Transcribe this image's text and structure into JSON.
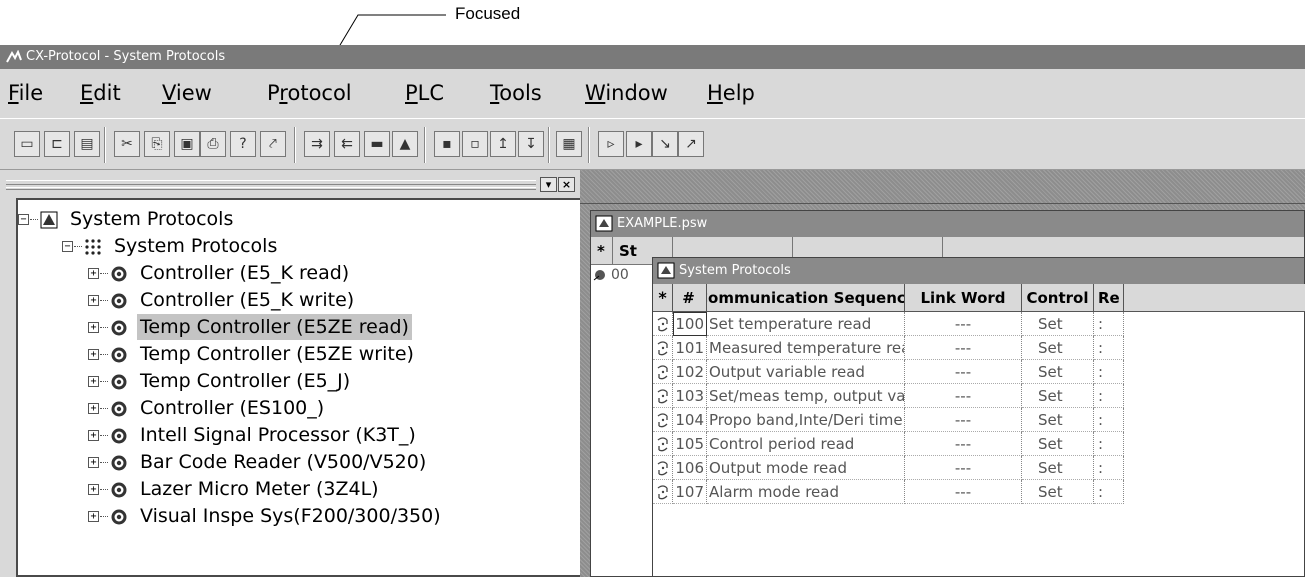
{
  "callout": {
    "label": "Focused"
  },
  "window": {
    "title": "CX-Protocol - System Protocols"
  },
  "menu": [
    {
      "label": "File",
      "underline": "F",
      "rest": "ile"
    },
    {
      "label": "Edit",
      "underline": "E",
      "rest": "dit"
    },
    {
      "label": "View",
      "underline": "V",
      "rest": "iew"
    },
    {
      "label": "Protocol",
      "underline": "r",
      "pre": "P",
      "rest": "otocol"
    },
    {
      "label": "PLC",
      "underline": "P",
      "rest": "LC"
    },
    {
      "label": "Tools",
      "underline": "T",
      "rest": "ools"
    },
    {
      "label": "Window",
      "underline": "W",
      "rest": "indow"
    },
    {
      "label": "Help",
      "underline": "H",
      "rest": "elp"
    }
  ],
  "toolbar": {
    "icons": [
      "new-icon",
      "open-icon",
      "save-icon",
      "cut-icon",
      "copy-icon",
      "paste-icon",
      "print-icon",
      "help-icon",
      "context-help-icon",
      "send-icon",
      "receive-icon",
      "stop-icon",
      "eject-icon",
      "trace-icon",
      "trace-stop-icon",
      "trace-up-icon",
      "trace-down-icon",
      "monitor-icon",
      "step-icon",
      "step-p-icon",
      "step-in-icon",
      "step-out-icon"
    ]
  },
  "tree": {
    "root": "System Protocols",
    "group": "System Protocols",
    "items": [
      "Controller (E5_K read)",
      "Controller (E5_K write)",
      "Temp Controller (E5ZE read)",
      "Temp Controller (E5ZE write)",
      "Temp Controller (E5_J)",
      "Controller (ES100_)",
      "Intell Signal Processor (K3T_)",
      "Bar Code Reader (V500/V520)",
      "Lazer Micro Meter (3Z4L)",
      "Visual Inspe Sys(F200/300/350)"
    ],
    "selected_index": 2
  },
  "example_window": {
    "title": "EXAMPLE.psw",
    "head_star": "*",
    "head_col": "St",
    "row_no": "00"
  },
  "system_window": {
    "title": "System Protocols",
    "headers": {
      "star": "*",
      "no": "#",
      "seq": "Communication Sequence",
      "link": "Link Word",
      "control": "Control",
      "r": "Re"
    },
    "rows": [
      {
        "no": "100",
        "seq": "Set temperature read",
        "link": "---",
        "control": "Set",
        "r": ":"
      },
      {
        "no": "101",
        "seq": "Measured temperature read",
        "link": "---",
        "control": "Set",
        "r": ":"
      },
      {
        "no": "102",
        "seq": "Output variable read",
        "link": "---",
        "control": "Set",
        "r": ":"
      },
      {
        "no": "103",
        "seq": "Set/meas temp, output var read",
        "link": "---",
        "control": "Set",
        "r": ":"
      },
      {
        "no": "104",
        "seq": "Propo band,Inte/Deri time read",
        "link": "---",
        "control": "Set",
        "r": ":"
      },
      {
        "no": "105",
        "seq": "Control period read",
        "link": "---",
        "control": "Set",
        "r": ":"
      },
      {
        "no": "106",
        "seq": "Output mode read",
        "link": "---",
        "control": "Set",
        "r": ":"
      },
      {
        "no": "107",
        "seq": "Alarm mode read",
        "link": "---",
        "control": "Set",
        "r": ":"
      }
    ]
  }
}
